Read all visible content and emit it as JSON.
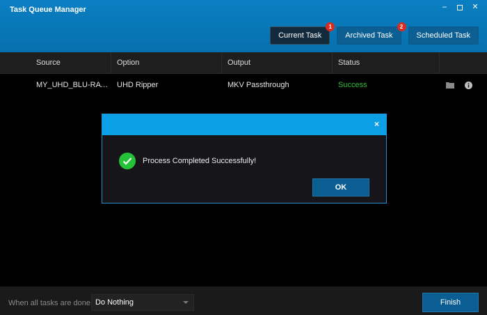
{
  "app": {
    "title": "Task Queue Manager"
  },
  "window_controls": {
    "minimize": "–",
    "close": "✕"
  },
  "tabs": [
    {
      "label": "Current Task",
      "badge": "1"
    },
    {
      "label": "Archived Task",
      "badge": "2"
    },
    {
      "label": "Scheduled Task",
      "badge": ""
    }
  ],
  "table": {
    "headers": [
      "Source",
      "Option",
      "Output",
      "Status"
    ],
    "rows": [
      {
        "source": "MY_UHD_BLU-RAY.Ti...",
        "option": "UHD Ripper",
        "output": "MKV Passthrough",
        "status": "Success"
      }
    ],
    "row_icons": [
      "folder-icon",
      "info-icon"
    ]
  },
  "dialog": {
    "message": "Process Completed Successfully!",
    "ok_label": "OK",
    "close_glyph": "×"
  },
  "footer": {
    "label": "When all tasks are done:",
    "select_value": "Do Nothing",
    "finish_label": "Finish"
  },
  "colors": {
    "accent": "#0d9fe6",
    "success": "#2dbf38",
    "badge": "#d92b1e"
  }
}
